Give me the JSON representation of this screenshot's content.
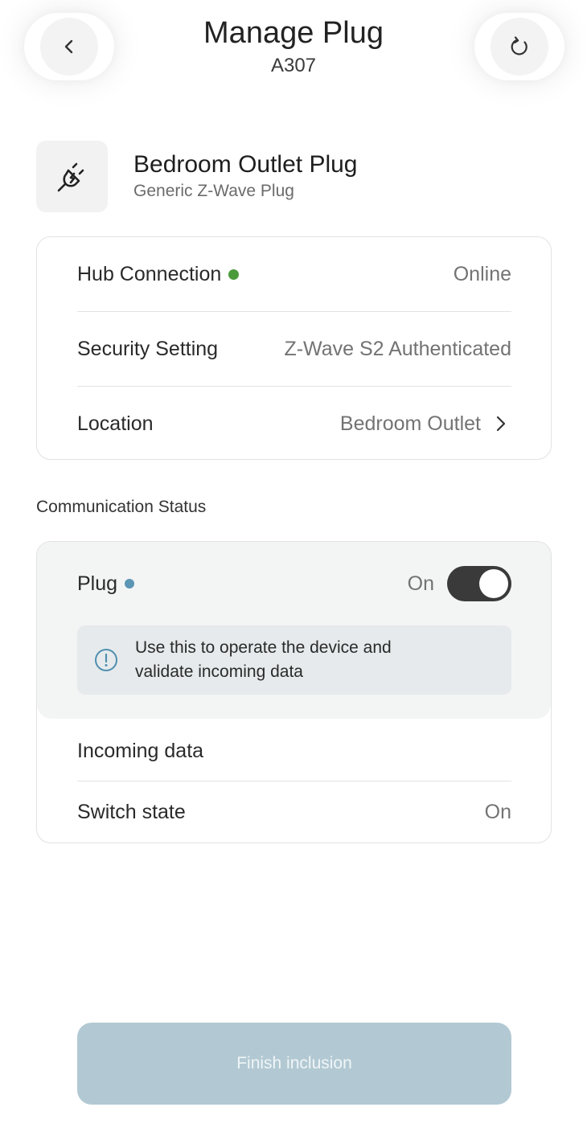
{
  "header": {
    "title": "Manage Plug",
    "subtitle": "A307",
    "back_icon": "chevron-left-icon",
    "refresh_icon": "refresh-icon"
  },
  "device": {
    "name": "Bedroom Outlet Plug",
    "model": "Generic Z-Wave Plug",
    "icon": "plug-icon"
  },
  "info": {
    "hub_connection_label": "Hub Connection",
    "hub_connection_value": "Online",
    "hub_status_color": "#4a9a3c",
    "security_label": "Security Setting",
    "security_value": "Z-Wave S2 Authenticated",
    "location_label": "Location",
    "location_value": "Bedroom Outlet"
  },
  "communication": {
    "section_title": "Communication Status",
    "plug_label": "Plug",
    "plug_status_color": "#5b96b5",
    "plug_state_label": "On",
    "plug_toggle_on": true,
    "notice_text_line1": "Use this to operate the device and",
    "notice_text_line2": "validate incoming data",
    "incoming_label": "Incoming data",
    "switch_state_label": "Switch state",
    "switch_state_value": "On"
  },
  "footer": {
    "finish_label": "Finish inclusion",
    "finish_bg": "#b2c9d3"
  }
}
